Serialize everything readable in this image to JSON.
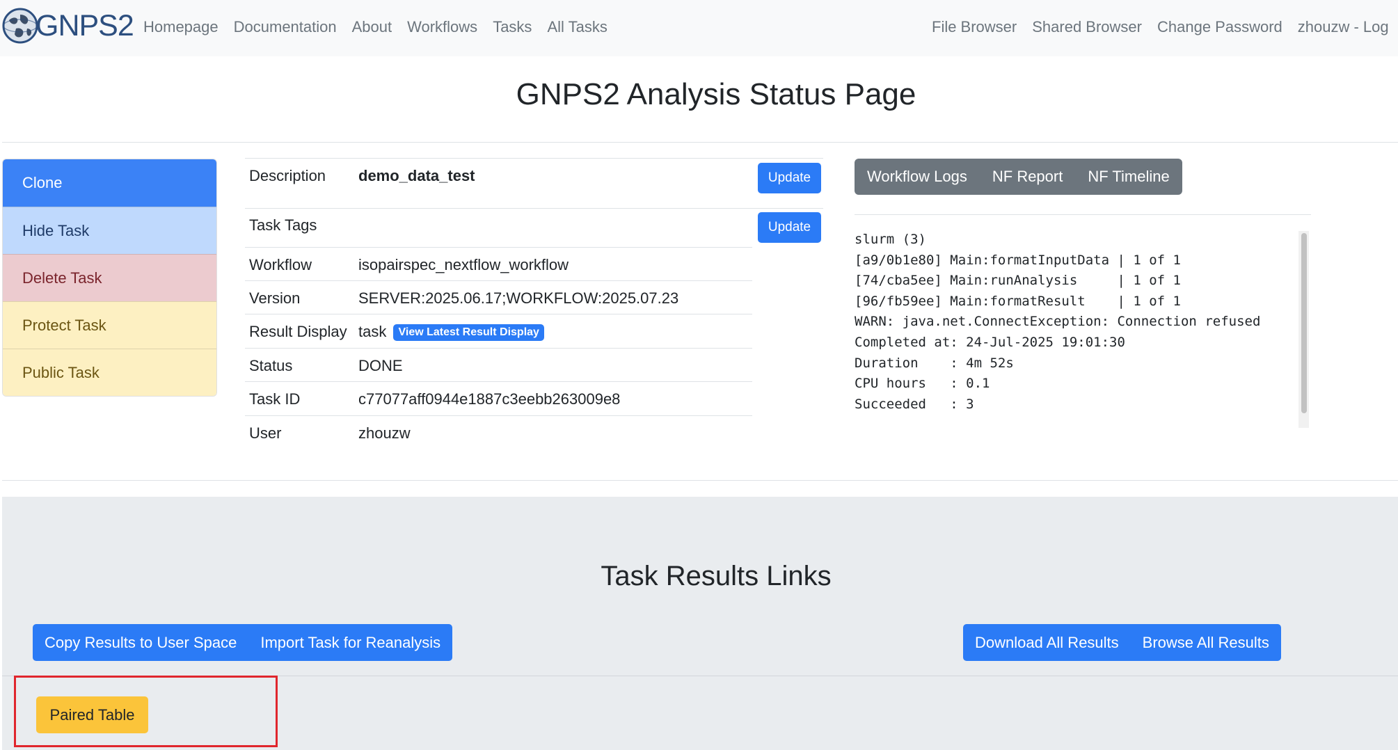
{
  "navbar": {
    "brand_text": "GNPS2",
    "left_links": [
      "Homepage",
      "Documentation",
      "About",
      "Workflows",
      "Tasks",
      "All Tasks"
    ],
    "right_links": [
      "File Browser",
      "Shared Browser",
      "Change Password",
      "zhouzw - Log"
    ]
  },
  "page_title": "GNPS2 Analysis Status Page",
  "actions": {
    "clone": "Clone",
    "hide": "Hide Task",
    "delete": "Delete Task",
    "protect": "Protect Task",
    "public": "Public Task"
  },
  "task_info": {
    "description_label": "Description",
    "description_value": "demo_data_test",
    "update_label": "Update",
    "tags_label": "Task Tags",
    "workflow_label": "Workflow",
    "workflow_value": "isopairspec_nextflow_workflow",
    "version_label": "Version",
    "version_value": "SERVER:2025.06.17;WORKFLOW:2025.07.23",
    "result_display_label": "Result Display",
    "result_display_value": "task",
    "result_display_link": "View Latest Result Display",
    "status_label": "Status",
    "status_value": "DONE",
    "task_id_label": "Task ID",
    "task_id_value": "c77077aff0944e1887c3eebb263009e8",
    "user_label": "User",
    "user_value": "zhouzw"
  },
  "log_panel": {
    "buttons": [
      "Workflow Logs",
      "NF Report",
      "NF Timeline"
    ],
    "lines": [
      "slurm (3)",
      "[a9/0b1e80] Main:formatInputData | 1 of 1",
      "[74/cba5ee] Main:runAnalysis     | 1 of 1",
      "[96/fb59ee] Main:formatResult    | 1 of 1",
      "WARN: java.net.ConnectException: Connection refused",
      "Completed at: 24-Jul-2025 19:01:30",
      "Duration    : 4m 52s",
      "CPU hours   : 0.1",
      "Succeeded   : 3"
    ]
  },
  "results": {
    "title": "Task Results Links",
    "copy_label": "Copy Results to User Space",
    "import_label": "Import Task for Reanalysis",
    "download_label": "Download All Results",
    "browse_label": "Browse All Results",
    "paired_table_label": "Paired Table"
  },
  "colors": {
    "primary": "#2b7bf6",
    "secondary": "#6c757d",
    "warning": "#fbc43a",
    "highlight": "#e0262d"
  }
}
